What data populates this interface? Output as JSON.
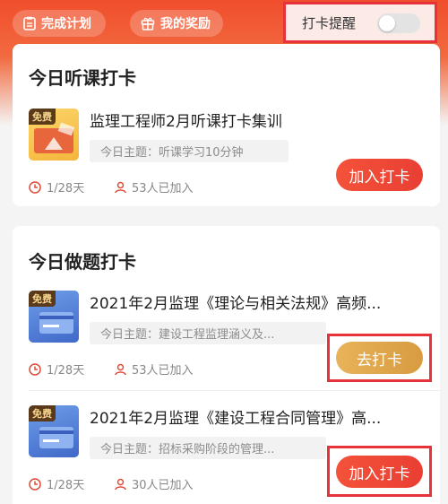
{
  "header": {
    "plan_label": "完成计划",
    "reward_label": "我的奖励",
    "reminder_label": "打卡提醒",
    "reminder_on": false
  },
  "listen": {
    "title": "今日听课打卡",
    "course": {
      "badge": "免费",
      "title": "监理工程师2月听课打卡集训",
      "topic": "今日主题：听课学习10分钟",
      "days": "1/28天",
      "joined": "53人已加入",
      "button": "加入打卡"
    }
  },
  "practice": {
    "title": "今日做题打卡",
    "courses": [
      {
        "badge": "免费",
        "title": "2021年2月监理《理论与相关法规》高频...",
        "topic": "今日主题：建设工程监理涵义及...",
        "days": "1/28天",
        "joined": "53人已加入",
        "button": "去打卡"
      },
      {
        "badge": "免费",
        "title": "2021年2月监理《建设工程合同管理》高...",
        "topic": "今日主题：招标采购阶段的管理...",
        "days": "1/28天",
        "joined": "30人已加入",
        "button": "加入打卡"
      }
    ]
  },
  "colors": {
    "accent": "#f04e2c",
    "join_button": "#e93f33",
    "go_button": "#d89b40",
    "highlight": "#e5323b"
  }
}
